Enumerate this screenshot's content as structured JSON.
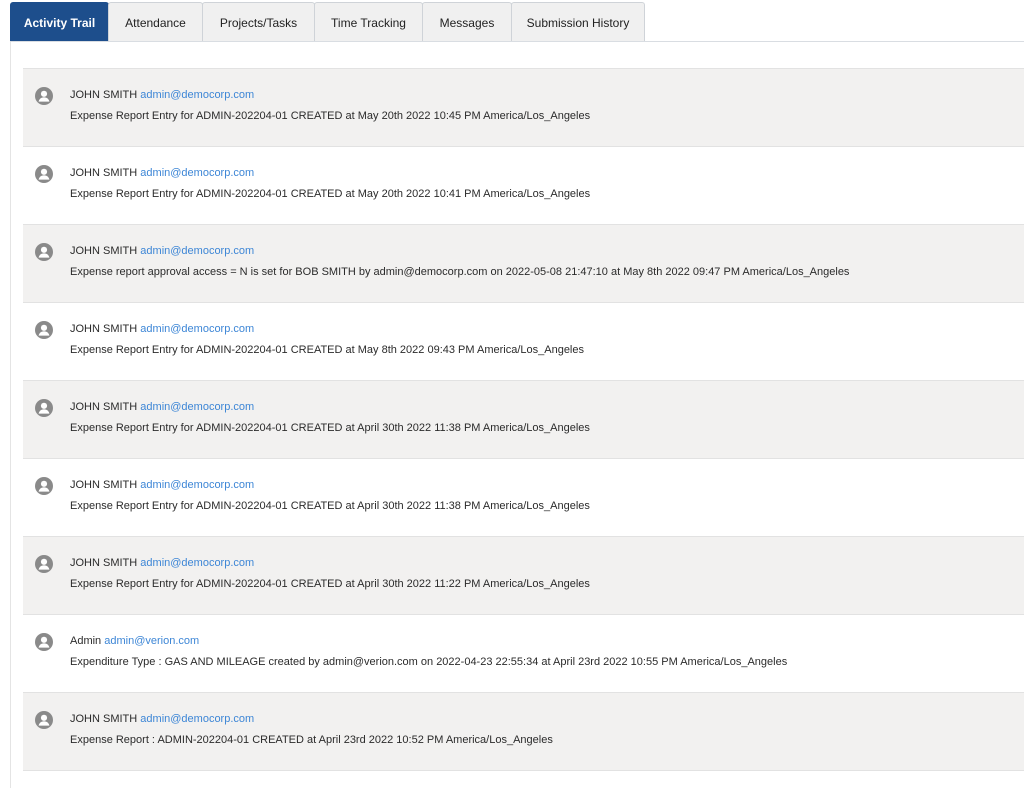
{
  "tabs": [
    {
      "label": "Activity Trail",
      "active": true
    },
    {
      "label": "Attendance",
      "active": false
    },
    {
      "label": "Projects/Tasks",
      "active": false
    },
    {
      "label": "Time Tracking",
      "active": false
    },
    {
      "label": "Messages",
      "active": false
    },
    {
      "label": "Submission History",
      "active": false
    }
  ],
  "activity": [
    {
      "user": "JOHN SMITH",
      "email": "admin@democorp.com",
      "description": "Expense Report Entry for ADMIN-202204-01 CREATED at May 20th 2022 10:45 PM America/Los_Angeles"
    },
    {
      "user": "JOHN SMITH",
      "email": "admin@democorp.com",
      "description": "Expense Report Entry for ADMIN-202204-01 CREATED at May 20th 2022 10:41 PM America/Los_Angeles"
    },
    {
      "user": "JOHN SMITH",
      "email": "admin@democorp.com",
      "description": "Expense report approval access = N is set for BOB SMITH by admin@democorp.com on 2022-05-08 21:47:10 at May 8th 2022 09:47 PM America/Los_Angeles"
    },
    {
      "user": "JOHN SMITH",
      "email": "admin@democorp.com",
      "description": "Expense Report Entry for ADMIN-202204-01 CREATED at May 8th 2022 09:43 PM America/Los_Angeles"
    },
    {
      "user": "JOHN SMITH",
      "email": "admin@democorp.com",
      "description": "Expense Report Entry for ADMIN-202204-01 CREATED at April 30th 2022 11:38 PM America/Los_Angeles"
    },
    {
      "user": "JOHN SMITH",
      "email": "admin@democorp.com",
      "description": "Expense Report Entry for ADMIN-202204-01 CREATED at April 30th 2022 11:38 PM America/Los_Angeles"
    },
    {
      "user": "JOHN SMITH",
      "email": "admin@democorp.com",
      "description": "Expense Report Entry for ADMIN-202204-01 CREATED at April 30th 2022 11:22 PM America/Los_Angeles"
    },
    {
      "user": "Admin",
      "email": "admin@verion.com",
      "description": "Expenditure Type : GAS AND MILEAGE created by admin@verion.com on 2022-04-23 22:55:34 at April 23rd 2022 10:55 PM America/Los_Angeles"
    },
    {
      "user": "JOHN SMITH",
      "email": "admin@democorp.com",
      "description": "Expense Report : ADMIN-202204-01 CREATED at April 23rd 2022 10:52 PM America/Los_Angeles"
    }
  ]
}
